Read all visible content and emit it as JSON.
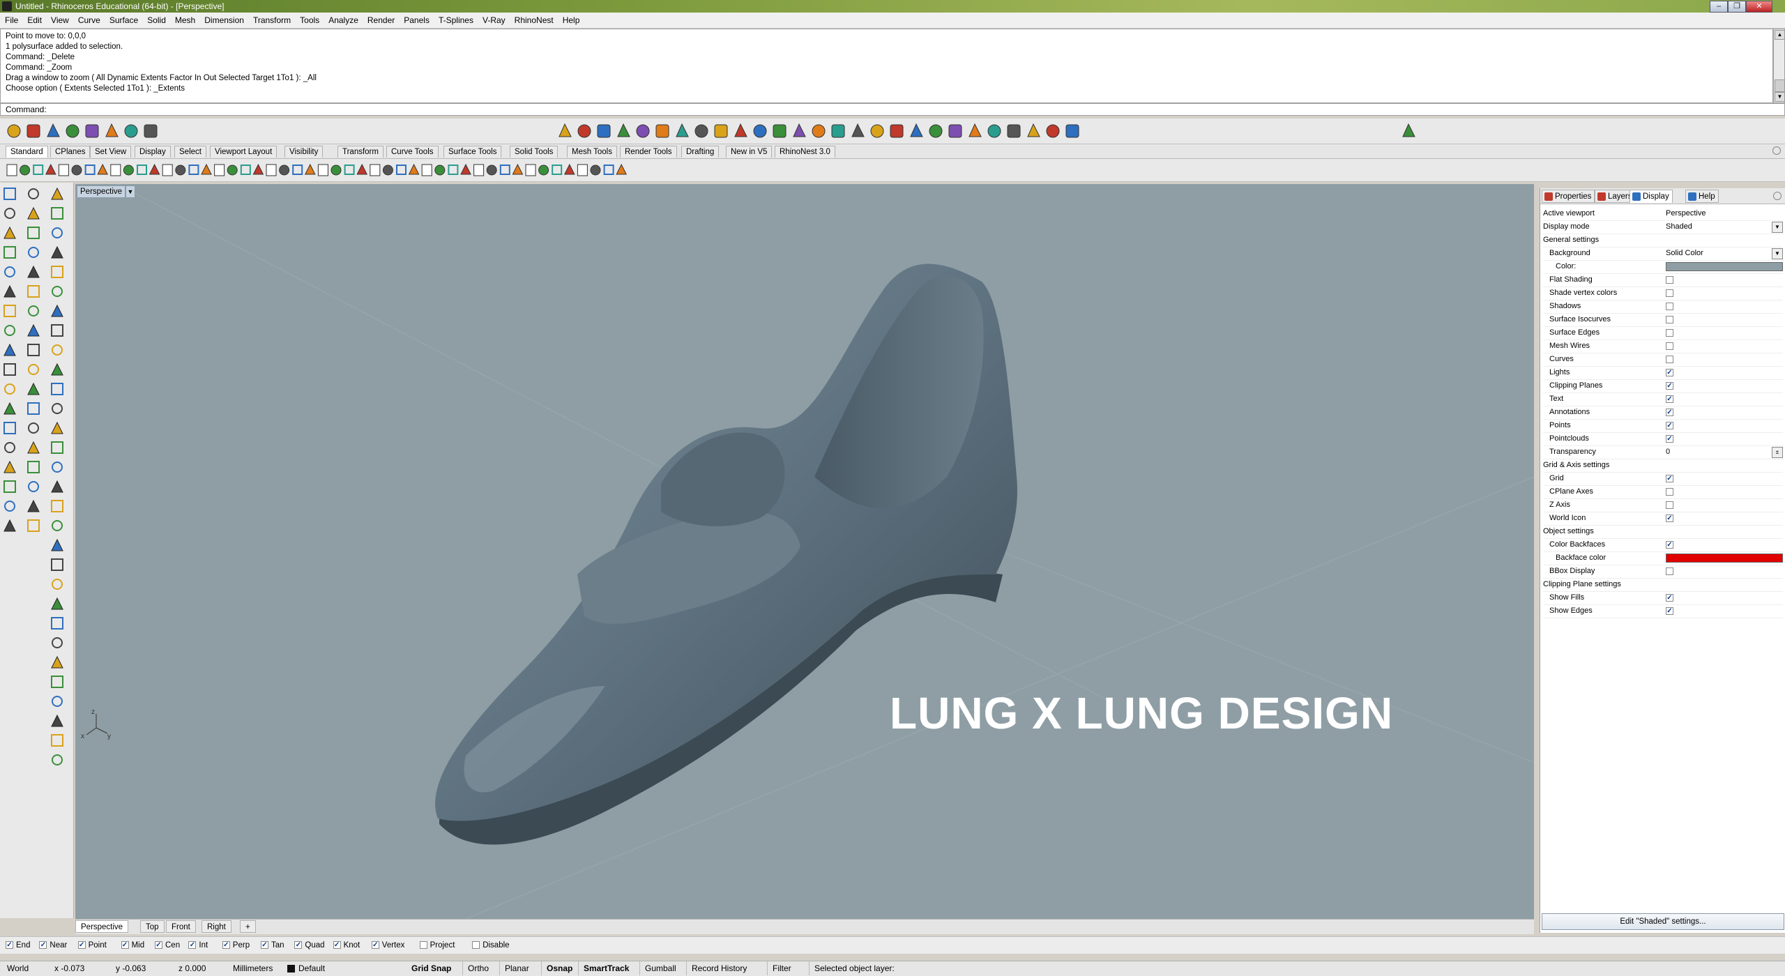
{
  "window": {
    "title": "Untitled - Rhinoceros Educational (64-bit) - [Perspective]",
    "controls": [
      "–",
      "❐",
      "✕"
    ]
  },
  "menu": [
    "File",
    "Edit",
    "View",
    "Curve",
    "Surface",
    "Solid",
    "Mesh",
    "Dimension",
    "Transform",
    "Tools",
    "Analyze",
    "Render",
    "Panels",
    "T-Splines",
    "V-Ray",
    "RhinoNest",
    "Help"
  ],
  "command_history": [
    "Point to move to: 0,0,0",
    "1 polysurface added to selection.",
    "Command: _Delete",
    "Command: _Zoom",
    "Drag a window to zoom ( All  Dynamic  Extents  Factor  In  Out  Selected  Target  1To1 ): _All",
    "Choose option ( Extents  Selected  1To1 ): _Extents"
  ],
  "command_prompt": "Command:",
  "toolbar_tabs": [
    "Standard",
    "CPlanes",
    "Set View",
    "Display",
    "Select",
    "Viewport Layout",
    "Visibility",
    "Transform",
    "Curve Tools",
    "Surface Tools",
    "Solid Tools",
    "Mesh Tools",
    "Render Tools",
    "Drafting",
    "New in V5",
    "RhinoNest 3.0"
  ],
  "viewport": {
    "name": "Perspective",
    "watermark": "LUNG X LUNG DESIGN",
    "background": "#8e9ea4",
    "model_color": "#5f7280",
    "axes": {
      "x": "x",
      "y": "y",
      "z": "z"
    }
  },
  "view_tabs": [
    "Perspective",
    "Top",
    "Front",
    "Right"
  ],
  "view_tab_add": "+",
  "panel": {
    "tabs": [
      "Properties",
      "Layers",
      "Display",
      "Help"
    ],
    "rows": [
      {
        "label": "Active viewport",
        "value": "Perspective"
      },
      {
        "label": "Display mode",
        "value": "Shaded",
        "dropdown": true
      },
      {
        "label": "General settings",
        "section": true
      },
      {
        "label": "Background",
        "value": "Solid Color",
        "dropdown": true,
        "indent": 1
      },
      {
        "label": "Color:",
        "swatch": "#8e9ea4",
        "indent": 2
      },
      {
        "label": "Flat Shading",
        "checked": false,
        "indent": 1
      },
      {
        "label": "Shade vertex colors",
        "checked": false,
        "indent": 1
      },
      {
        "label": "Shadows",
        "checked": false,
        "indent": 1
      },
      {
        "label": "Surface Isocurves",
        "checked": false,
        "indent": 1
      },
      {
        "label": "Surface Edges",
        "checked": false,
        "indent": 1
      },
      {
        "label": "Mesh Wires",
        "checked": false,
        "indent": 1
      },
      {
        "label": "Curves",
        "checked": false,
        "indent": 1
      },
      {
        "label": "Lights",
        "checked": true,
        "indent": 1
      },
      {
        "label": "Clipping Planes",
        "checked": true,
        "indent": 1
      },
      {
        "label": "Text",
        "checked": true,
        "indent": 1
      },
      {
        "label": "Annotations",
        "checked": true,
        "indent": 1
      },
      {
        "label": "Points",
        "checked": true,
        "indent": 1
      },
      {
        "label": "Pointclouds",
        "checked": true,
        "indent": 1
      },
      {
        "label": "Transparency",
        "value": "0",
        "indent": 1,
        "spinner": true
      },
      {
        "label": "Grid & Axis settings",
        "section": true
      },
      {
        "label": "Grid",
        "checked": true,
        "indent": 1
      },
      {
        "label": "CPlane Axes",
        "checked": false,
        "indent": 1
      },
      {
        "label": "Z Axis",
        "checked": false,
        "indent": 1
      },
      {
        "label": "World Icon",
        "checked": true,
        "indent": 1
      },
      {
        "label": "Object settings",
        "section": true
      },
      {
        "label": "Color Backfaces",
        "checked": true,
        "indent": 1
      },
      {
        "label": "Backface color",
        "swatch": "#e00000",
        "indent": 2
      },
      {
        "label": "BBox Display",
        "checked": false,
        "indent": 1
      },
      {
        "label": "Clipping Plane settings",
        "section": true
      },
      {
        "label": "Show Fills",
        "checked": true,
        "indent": 1
      },
      {
        "label": "Show Edges",
        "checked": true,
        "indent": 1
      }
    ],
    "edit_button": "Edit \"Shaded\" settings..."
  },
  "osnaps": [
    {
      "label": "End",
      "checked": true
    },
    {
      "label": "Near",
      "checked": true
    },
    {
      "label": "Point",
      "checked": true
    },
    {
      "label": "Mid",
      "checked": true
    },
    {
      "label": "Cen",
      "checked": true
    },
    {
      "label": "Int",
      "checked": true
    },
    {
      "label": "Perp",
      "checked": true
    },
    {
      "label": "Tan",
      "checked": true
    },
    {
      "label": "Quad",
      "checked": true
    },
    {
      "label": "Knot",
      "checked": true
    },
    {
      "label": "Vertex",
      "checked": true
    },
    {
      "label": "Project",
      "checked": false
    },
    {
      "label": "Disable",
      "checked": false
    }
  ],
  "status": {
    "cplane": "World",
    "x": "x -0.073",
    "y": "y -0.063",
    "z": "z 0.000",
    "units": "Millimeters",
    "layer": "Default",
    "toggles": [
      "Grid Snap",
      "Ortho",
      "Planar",
      "Osnap",
      "SmartTrack",
      "Gumball",
      "Record History",
      "Filter"
    ],
    "bold_toggles": [
      "Grid Snap",
      "Osnap",
      "SmartTrack"
    ],
    "message": "Selected object layer:"
  }
}
